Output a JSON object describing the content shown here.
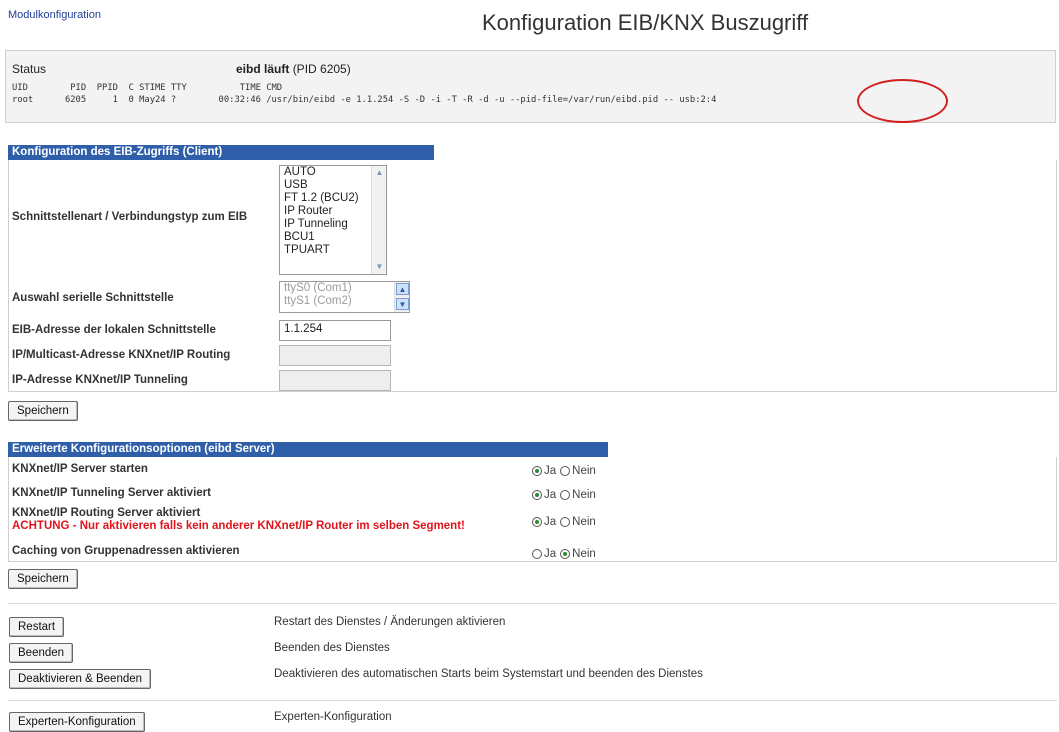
{
  "nav": {
    "link": "Modulkonfiguration"
  },
  "page_title": "Konfiguration EIB/KNX Buszugriff",
  "status": {
    "label": "Status",
    "state": "eibd läuft",
    "pid_text": "(PID 6205)",
    "proc_header": "UID        PID  PPID  C STIME TTY          TIME CMD",
    "proc_row": "root      6205     1  0 May24 ?        00:32:46 /usr/bin/eibd -e 1.1.254 -S -D -i -T -R -d -u --pid-file=/var/run/eibd.pid -- usb:2:4",
    "highlight_color": "#d21f1f"
  },
  "client_section": {
    "header": "Konfiguration des EIB-Zugriffs (Client)",
    "interface_label": "Schnittstellenart / Verbindungstyp zum EIB",
    "interface_options": [
      "AUTO",
      "USB",
      "FT 1.2 (BCU2)",
      "IP Router",
      "IP Tunneling",
      "BCU1",
      "TPUART"
    ],
    "serial_label": "Auswahl serielle Schnittstelle",
    "serial_options": [
      "ttyS0 (Com1)",
      "ttyS1 (Com2)"
    ],
    "eib_address_label": "EIB-Adresse der lokalen Schnittstelle",
    "eib_address_value": "1.1.254",
    "multicast_label": "IP/Multicast-Adresse KNXnet/IP Routing",
    "multicast_value": "",
    "tunnel_ip_label": "IP-Adresse KNXnet/IP Tunneling",
    "tunnel_ip_value": "",
    "save_label": "Speichern"
  },
  "server_section": {
    "header": "Erweiterte Konfigurationsoptionen (eibd Server)",
    "yes_label": "Ja",
    "no_label": "Nein",
    "rows": [
      {
        "label": "KNXnet/IP Server starten",
        "selected": "Ja"
      },
      {
        "label": "KNXnet/IP Tunneling Server aktiviert",
        "selected": "Ja"
      },
      {
        "label": "KNXnet/IP Routing Server aktiviert",
        "warning": "ACHTUNG - Nur aktivieren falls kein anderer KNXnet/IP Router im selben Segment!",
        "selected": "Ja"
      },
      {
        "label": "Caching von Gruppenadressen aktivieren",
        "selected": "Nein"
      }
    ],
    "save_label": "Speichern"
  },
  "actions": [
    {
      "button": "Restart",
      "desc": "Restart des Dienstes / Änderungen aktivieren"
    },
    {
      "button": "Beenden",
      "desc": "Beenden des Dienstes"
    },
    {
      "button": "Deaktivieren & Beenden",
      "desc": "Deaktivieren des automatischen Starts beim Systemstart und beenden des Dienstes"
    },
    {
      "button": "Experten-Konfiguration",
      "desc": "Experten-Konfiguration"
    }
  ]
}
